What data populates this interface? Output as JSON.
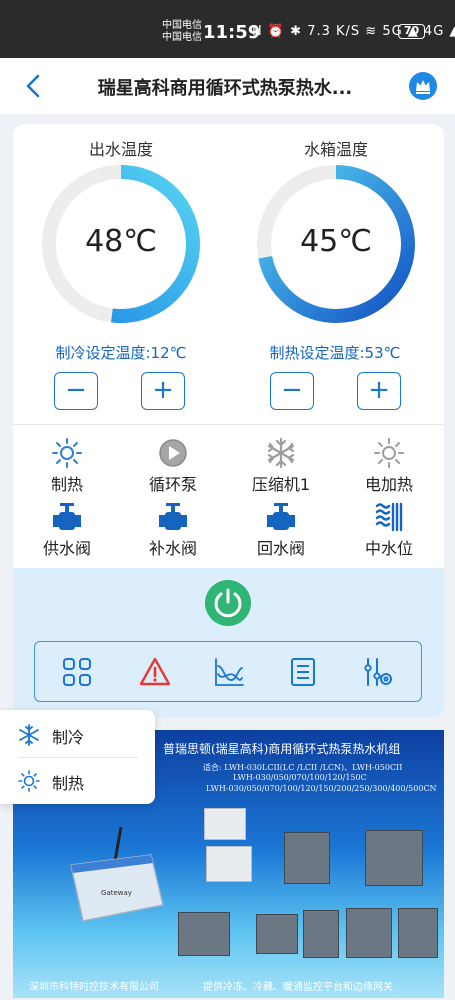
{
  "status_bar": {
    "carrier_1": "中国电信",
    "carrier_2": "中国电信",
    "time": "11:59",
    "icons": "N ⏰ ✱ 7.3 K/S ≋ 5G ▲ 4G ▲",
    "battery": "70"
  },
  "header": {
    "title": "瑞星高科商用循环式热泵热水...",
    "back_icon": "chevron-left-icon",
    "crown_icon": "crown-icon"
  },
  "gauges": [
    {
      "label": "出水温度",
      "value": "48℃",
      "fill": 0.52,
      "setpoint": "制冷设定温度:12℃"
    },
    {
      "label": "水箱温度",
      "value": "45℃",
      "fill": 0.72,
      "setpoint": "制热设定温度:53℃"
    }
  ],
  "stepper": {
    "minus": "−",
    "plus": "+"
  },
  "status_items": [
    {
      "label": "制热",
      "icon": "sun-icon",
      "color": "#2f7fd8"
    },
    {
      "label": "循环泵",
      "icon": "play-circle-icon",
      "color": "#9e9e9e"
    },
    {
      "label": "压缩机1",
      "icon": "snowflake-icon",
      "color": "#9e9e9e"
    },
    {
      "label": "电加热",
      "icon": "sun-icon",
      "color": "#9e9e9e"
    },
    {
      "label": "供水阀",
      "icon": "valve-icon",
      "color": "#1565c0"
    },
    {
      "label": "补水阀",
      "icon": "valve-icon",
      "color": "#1565c0"
    },
    {
      "label": "回水阀",
      "icon": "valve-icon",
      "color": "#1565c0"
    },
    {
      "label": "中水位",
      "icon": "water-level-icon",
      "color": "#1565c0"
    }
  ],
  "toolbar": [
    {
      "icon": "grid-icon"
    },
    {
      "icon": "warning-icon"
    },
    {
      "icon": "chart-icon"
    },
    {
      "icon": "list-icon"
    },
    {
      "icon": "settings-sliders-icon"
    }
  ],
  "popup": [
    {
      "label": "制冷",
      "icon": "snowflake-icon"
    },
    {
      "label": "制热",
      "icon": "sun-icon"
    }
  ],
  "banner": {
    "title": "普瑞思顿(瑞星高科)商用循环式热泵热水机组",
    "lines": [
      "适合: LWH-030LCII(LC /LCII /LCN)、LWH-050CII",
      "LWH-030/050/070/100/120/150C",
      "LWH-030/050/070/100/120/150/200/250/300/400/500CN"
    ],
    "footer_left": "深圳市科特时控技术有限公司",
    "footer_right": "提供冷冻、冷藏、暖通监控平台和边缘网关",
    "device_label": "Gateway"
  },
  "colors": {
    "accent": "#1976d2",
    "power": "#2fb574",
    "warning": "#e53935"
  }
}
